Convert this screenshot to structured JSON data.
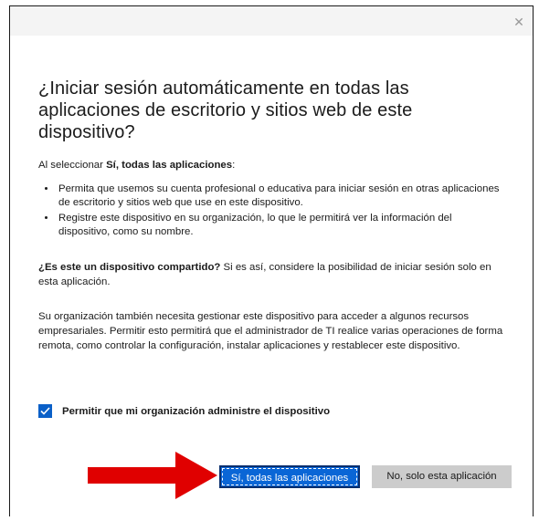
{
  "dialog": {
    "close_glyph": "✕",
    "heading": "¿Iniciar sesión automáticamente en todas las aplicaciones de escritorio y sitios web de este dispositivo?",
    "intro_prefix": "Al seleccionar ",
    "intro_bold": "Sí, todas las aplicaciones",
    "intro_suffix": ":",
    "bullets": [
      "Permita que usemos su cuenta profesional o educativa para iniciar sesión en otras aplicaciones de escritorio y sitios web que use en este dispositivo.",
      "Registre este dispositivo en su organización, lo que le permitirá ver la información del dispositivo, como su nombre."
    ],
    "shared_bold": "¿Es este un dispositivo compartido?",
    "shared_rest": " Si es así, considere la posibilidad de iniciar sesión solo en esta aplicación.",
    "management_text": "Su organización también necesita gestionar este dispositivo para acceder a algunos recursos empresariales. Permitir esto permitirá que el administrador de TI realice varias operaciones de forma remota, como controlar la configuración, instalar aplicaciones y restablecer este dispositivo.",
    "checkbox_label": "Permitir que mi organización administre el dispositivo",
    "checkbox_checked": true,
    "yes_button": "Sí, todas las aplicaciones",
    "no_button": "No, solo esta aplicación"
  },
  "colors": {
    "accent": "#0a66d6",
    "arrow": "#e00000",
    "secondary_button": "#cccccc"
  },
  "icons": {
    "close": "close-icon",
    "check": "checkmark-icon",
    "annotation": "red-arrow-icon"
  }
}
